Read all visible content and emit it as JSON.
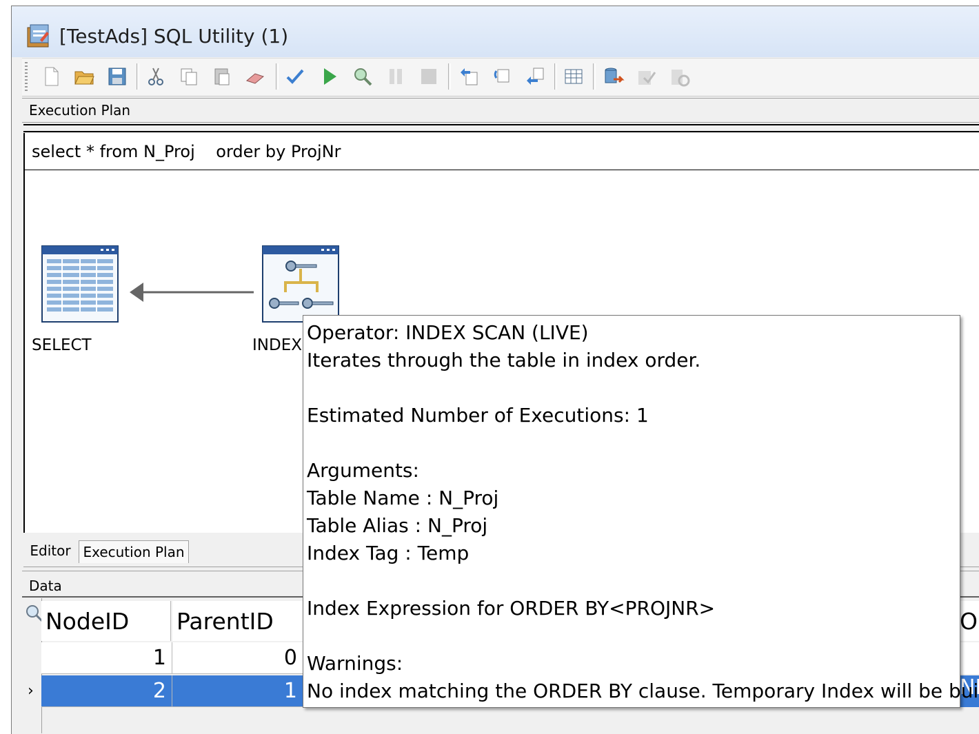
{
  "window": {
    "title": "[TestAds] SQL Utility (1)"
  },
  "toolbar": {
    "buttons": [
      {
        "name": "new-file-icon"
      },
      {
        "name": "open-folder-icon"
      },
      {
        "name": "save-icon"
      },
      {
        "name": "cut-icon"
      },
      {
        "name": "copy-icon"
      },
      {
        "name": "paste-icon"
      },
      {
        "name": "eraser-icon"
      },
      {
        "name": "verify-check-icon"
      },
      {
        "name": "run-icon"
      },
      {
        "name": "explain-plan-icon"
      },
      {
        "name": "pause-icon"
      },
      {
        "name": "stop-icon"
      },
      {
        "name": "undo-icon"
      },
      {
        "name": "redo-icon"
      },
      {
        "name": "transaction-icon"
      },
      {
        "name": "grid-options-icon"
      },
      {
        "name": "export-table-icon"
      },
      {
        "name": "commit-icon"
      },
      {
        "name": "rollback-icon"
      }
    ]
  },
  "plan": {
    "header": "Execution Plan",
    "sql": "select * from N_Proj    order by ProjNr",
    "nodes": [
      {
        "label": "SELECT"
      },
      {
        "label": "INDEX"
      }
    ]
  },
  "tabs": [
    {
      "label": "Editor"
    },
    {
      "label": "Execution Plan"
    }
  ],
  "data": {
    "header": "Data",
    "columns": [
      "NodeID",
      "ParentID",
      "Op"
    ],
    "rows": [
      {
        "nodeid": "1",
        "parentid": "0"
      },
      {
        "nodeid": "2",
        "parentid": "1",
        "tail": "ND"
      }
    ]
  },
  "tooltip": {
    "lines": [
      "Operator: INDEX SCAN (LIVE)",
      "Iterates through the table in index order.",
      "",
      "Estimated Number of Executions: 1",
      "",
      "Arguments:",
      "Table Name : N_Proj",
      "Table Alias : N_Proj",
      "Index Tag : Temp",
      "",
      "Index Expression for ORDER BY<PROJNR>",
      "",
      "Warnings:",
      "No index matching the ORDER BY clause. Temporary Index will be built."
    ]
  },
  "colors": {
    "selection": "#3a7bd5",
    "title_bar": "#d7e4f6"
  }
}
